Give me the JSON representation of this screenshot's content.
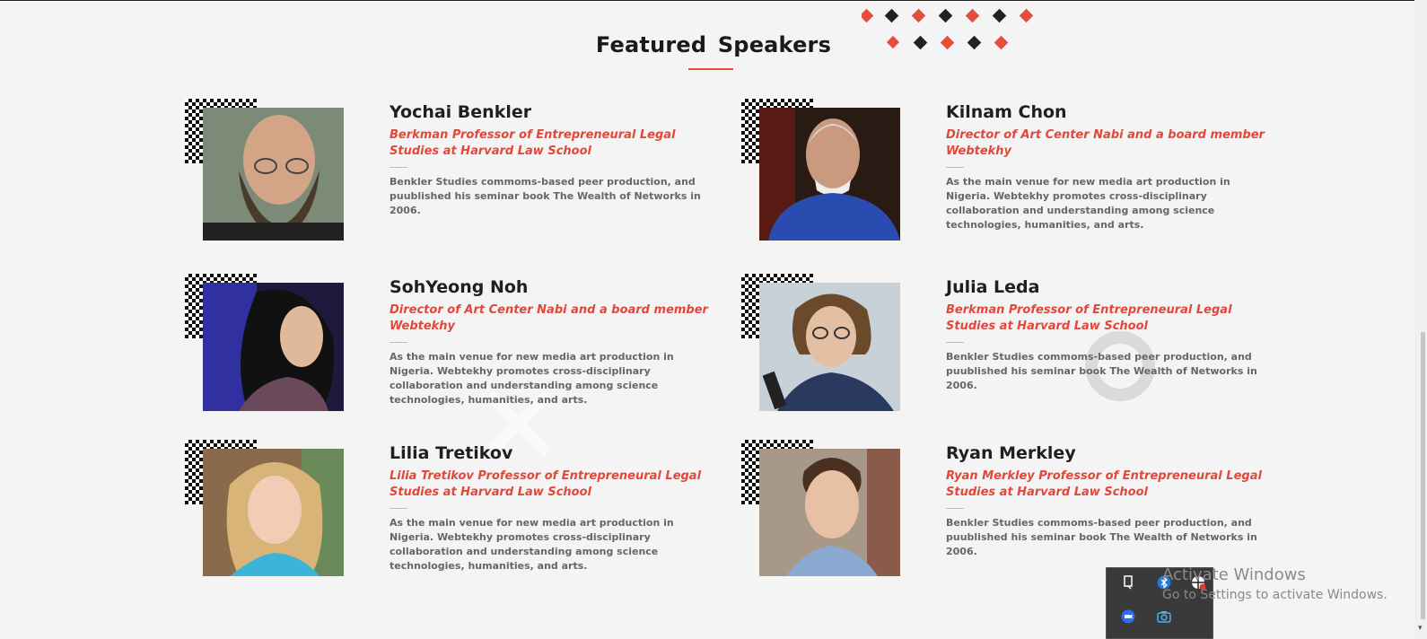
{
  "section": {
    "title": "Featured  Speakers"
  },
  "colors": {
    "accent": "#e2473a",
    "text": "#1f1f1f",
    "muted": "#666666",
    "background": "#f4f4f4"
  },
  "speakers": [
    {
      "name": "Yochai Benkler",
      "role": "Berkman Professor of Entrepreneural Legal Studies at Harvard Law School",
      "bio": "Benkler Studies commoms-based peer production, and puublished his seminar book The Wealth of Networks in 2006."
    },
    {
      "name": "Kilnam Chon",
      "role": "Director of Art Center Nabi and a board member Webtekhy",
      "bio": "As the main venue for new media art production in Nigeria. Webtekhy promotes cross-disciplinary collaboration and understanding among science technologies, humanities, and arts."
    },
    {
      "name": "SohYeong Noh",
      "role": "Director of Art Center Nabi and a board member Webtekhy",
      "bio": "As the main venue for new media art production in Nigeria. Webtekhy promotes cross-disciplinary collaboration and understanding among science technologies, humanities, and arts."
    },
    {
      "name": "Julia Leda",
      "role": "Berkman Professor of Entrepreneural Legal Studies at Harvard Law School",
      "bio": "Benkler Studies commoms-based peer production, and puublished his seminar book The Wealth of Networks in 2006."
    },
    {
      "name": "Lilia Tretikov",
      "role": "Lilia Tretikov Professor of Entrepreneural Legal Studies at Harvard Law School",
      "bio": "As the main venue for new media art production in Nigeria. Webtekhy promotes cross-disciplinary collaboration and understanding among science technologies, humanities, and arts."
    },
    {
      "name": "Ryan Merkley",
      "role": "Ryan Merkley Professor of Entrepreneural Legal Studies at Harvard Law School",
      "bio": "Benkler Studies commoms-based peer production, and puublished his seminar book The Wealth of Networks in 2006."
    }
  ],
  "tray": {
    "icons": [
      "usb-eject-icon",
      "bluetooth-icon",
      "security-alert-icon",
      "zoom-app-icon",
      "camera-icon"
    ]
  },
  "windows_watermark": {
    "title": "Activate Windows",
    "subtitle": "Go to Settings to activate Windows."
  }
}
